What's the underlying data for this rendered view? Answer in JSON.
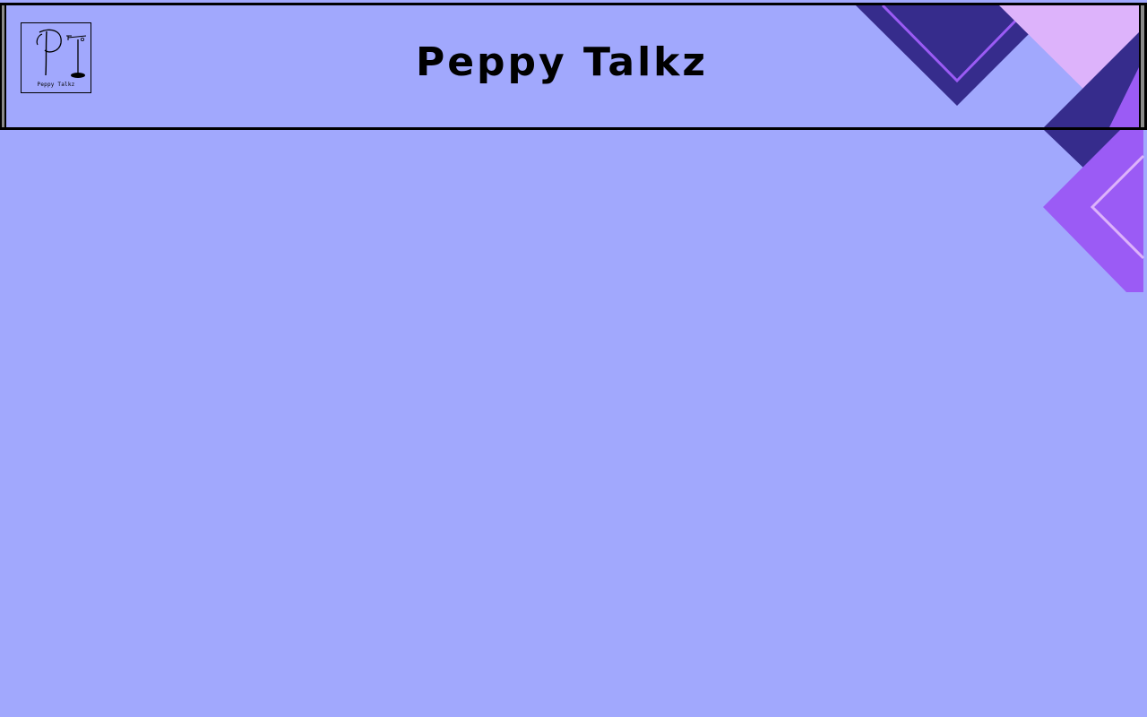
{
  "header": {
    "title": "Peppy Talkz",
    "logo": {
      "monogram": "PT",
      "caption": "Peppy Talkz"
    }
  },
  "colors": {
    "background": "#a1a8fd",
    "border": "#000000",
    "accent_dark": "#362c8c",
    "accent_purple": "#9b5bf5",
    "accent_pink": "#ddb3fb"
  }
}
